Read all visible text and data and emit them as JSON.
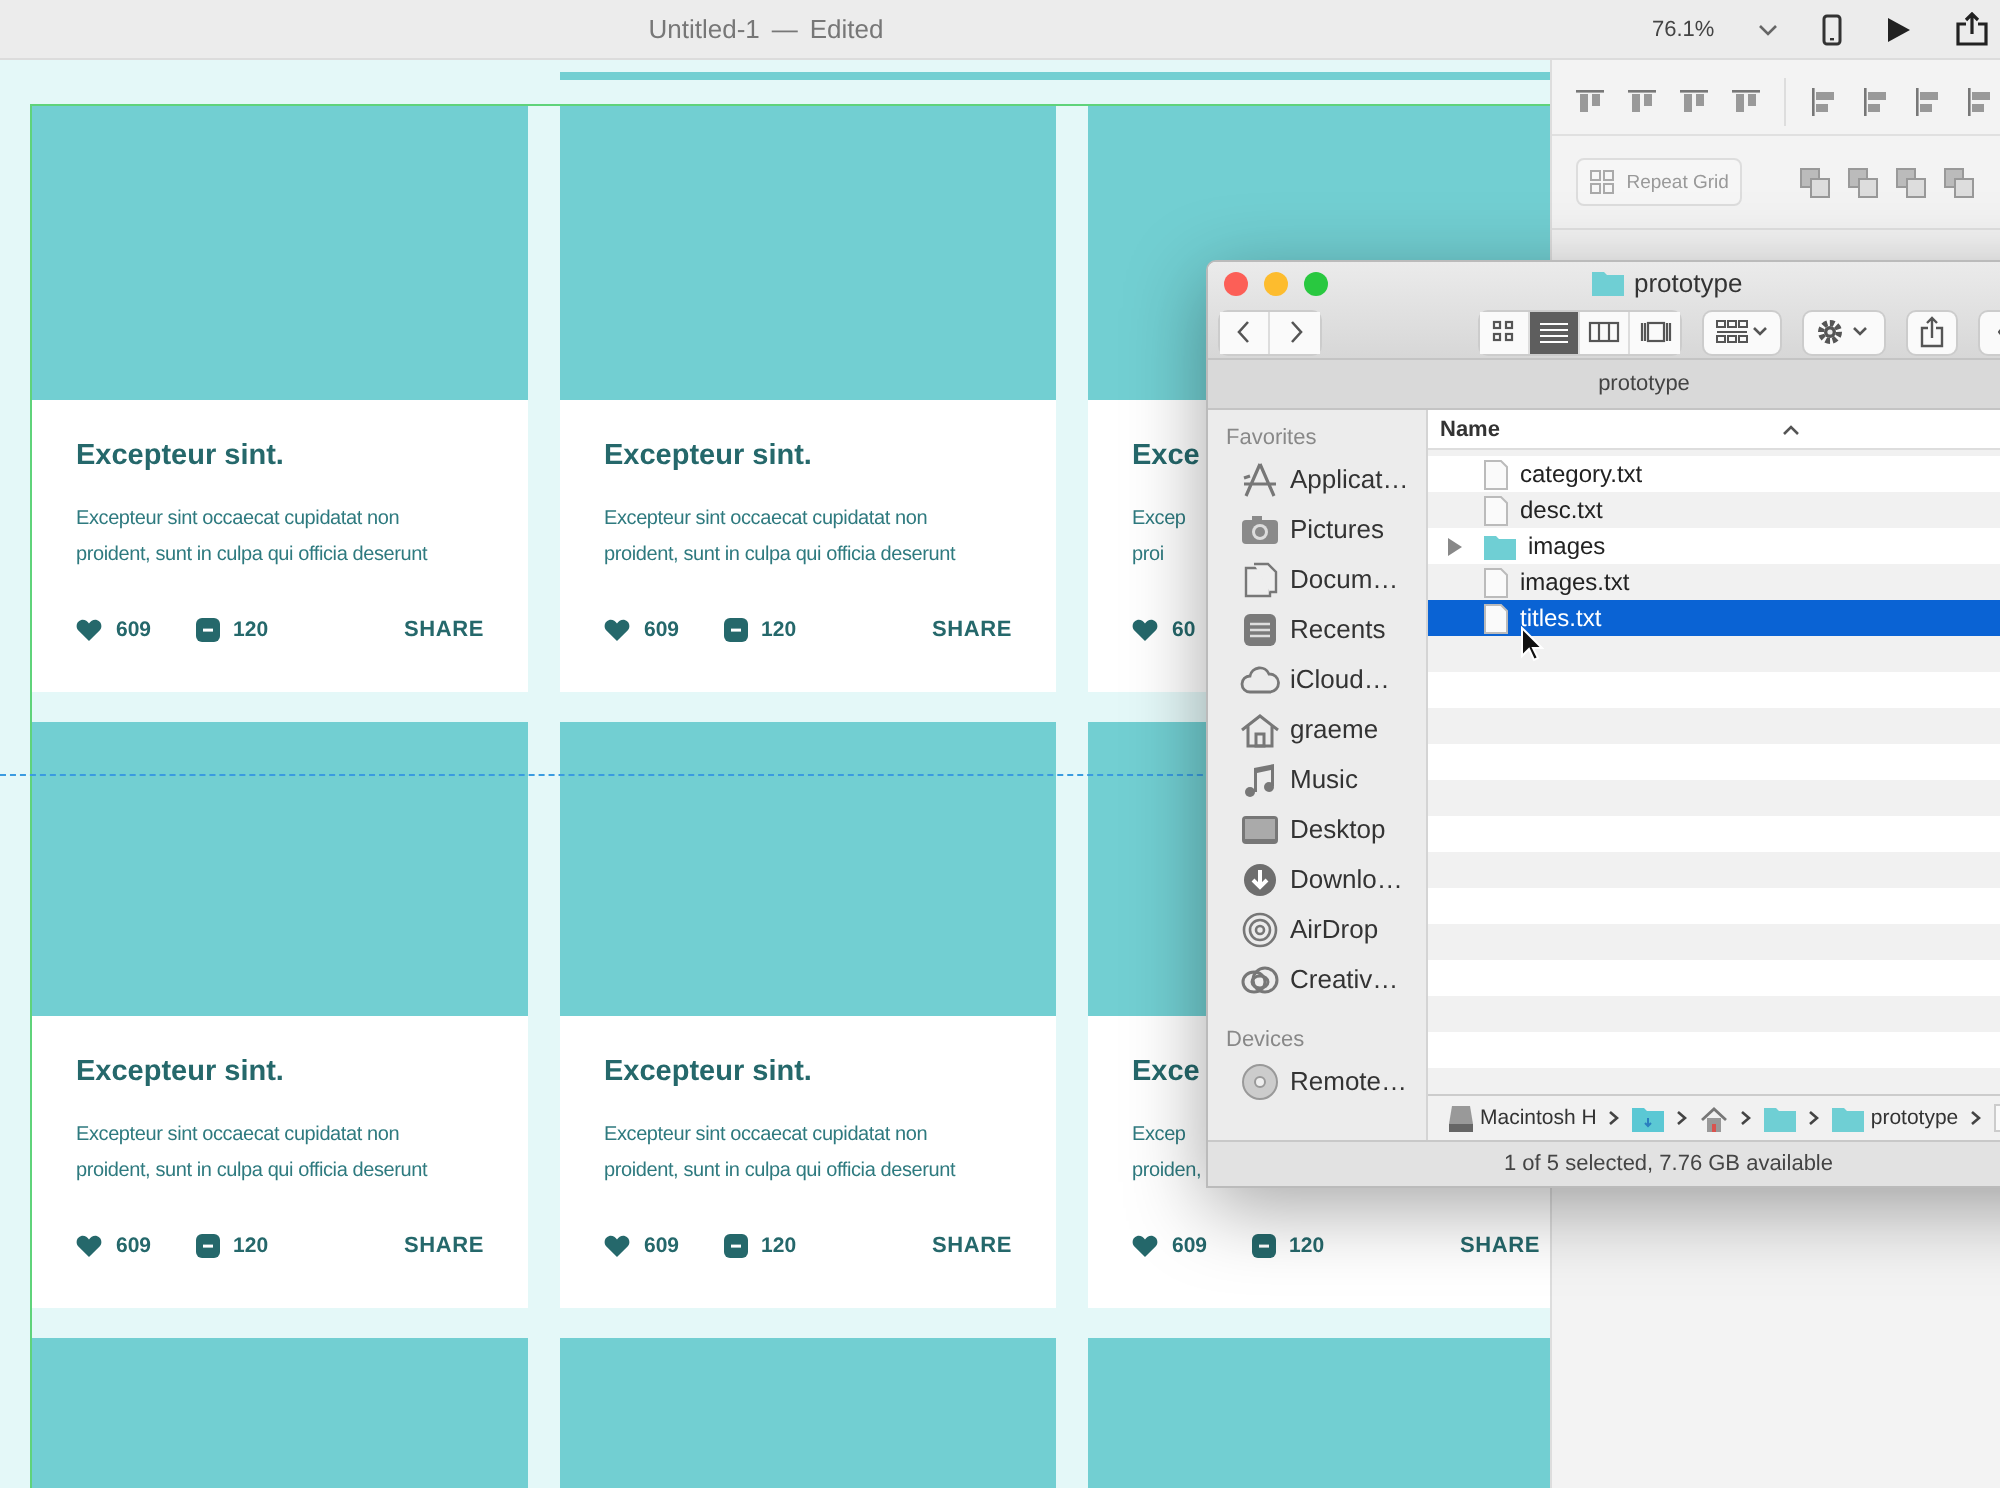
{
  "app_bar": {
    "title": "Untitled-1",
    "separator": "—",
    "status": "Edited",
    "zoom": "76.1%"
  },
  "canvas": {
    "card_rows": [
      [
        {
          "kind": "card",
          "title": "Excepteur sint.",
          "description_lines": [
            "Excepteur sint occaecat cupidatat non",
            "proident, sunt in culpa qui officia deserunt"
          ],
          "likes": "609",
          "comments": "120",
          "share": "SHARE"
        },
        {
          "kind": "card",
          "title": "Excepteur sint.",
          "description_lines": [
            "Excepteur sint occaecat cupidatat non",
            "proident, sunt in culpa qui officia deserunt"
          ],
          "likes": "609",
          "comments": "120",
          "share": "SHARE"
        },
        {
          "kind": "card",
          "title": "Exce",
          "description_lines": [
            "Excep",
            "proi"
          ],
          "likes": "60"
        }
      ],
      [
        {
          "kind": "card",
          "title": "Excepteur sint.",
          "description_lines": [
            "Excepteur sint occaecat cupidatat non",
            "proident, sunt in culpa qui officia deserunt"
          ],
          "likes": "609",
          "comments": "120",
          "share": "SHARE"
        },
        {
          "kind": "card",
          "title": "Excepteur sint.",
          "description_lines": [
            "Excepteur sint occaecat cupidatat non",
            "proident, sunt in culpa qui officia deserunt"
          ],
          "likes": "609",
          "comments": "120",
          "share": "SHARE"
        },
        {
          "kind": "card",
          "title": "Exce",
          "description_lines": [
            "Excep",
            "proiden,"
          ],
          "likes": "609",
          "comments": "120",
          "share": "SHARE"
        }
      ],
      [
        {
          "kind": "image-only"
        },
        {
          "kind": "image-only"
        },
        {
          "kind": "image-only"
        }
      ]
    ]
  },
  "property_panel": {
    "repeat_grid_button": "Repeat Grid"
  },
  "finder": {
    "title": "prototype",
    "view_modes": [
      {
        "kind": "icons",
        "selected": false
      },
      {
        "kind": "list",
        "selected": true
      },
      {
        "kind": "columns",
        "selected": false
      },
      {
        "kind": "gallery",
        "selected": false
      }
    ],
    "path_title": "prototype",
    "sidebar_sections": [
      {
        "heading": "Favorites",
        "items": [
          {
            "kind": "apps",
            "label": "Applicat…"
          },
          {
            "kind": "pictures",
            "label": "Pictures"
          },
          {
            "kind": "documents",
            "label": "Docum…"
          },
          {
            "kind": "recents",
            "label": "Recents"
          },
          {
            "kind": "cloud",
            "label": "iCloud…"
          },
          {
            "kind": "home",
            "label": "graeme"
          },
          {
            "kind": "music",
            "label": "Music"
          },
          {
            "kind": "desktop",
            "label": "Desktop"
          },
          {
            "kind": "downloads",
            "label": "Downlo…"
          },
          {
            "kind": "airdrop",
            "label": "AirDrop"
          },
          {
            "kind": "creative",
            "label": "Creativ…"
          }
        ]
      },
      {
        "heading": "Devices",
        "items": [
          {
            "kind": "disc",
            "label": "Remote…"
          }
        ]
      }
    ],
    "column_header": "Name",
    "files": [
      {
        "kind": "file",
        "name": "category.txt",
        "selected": false
      },
      {
        "kind": "file",
        "name": "desc.txt",
        "selected": false
      },
      {
        "kind": "folder",
        "name": "images",
        "selected": false,
        "expanded": false
      },
      {
        "kind": "file",
        "name": "images.txt",
        "selected": false
      },
      {
        "kind": "file",
        "name": "titles.txt",
        "selected": true
      }
    ],
    "path_bar": [
      {
        "kind": "drive",
        "label": "Macintosh H"
      },
      {
        "kind": "blue-folder"
      },
      {
        "kind": "home"
      },
      {
        "kind": "folder"
      },
      {
        "kind": "folder",
        "label": "prototype"
      },
      {
        "kind": "file"
      }
    ],
    "status": "1 of 5 selected, 7.76 GB available"
  }
}
